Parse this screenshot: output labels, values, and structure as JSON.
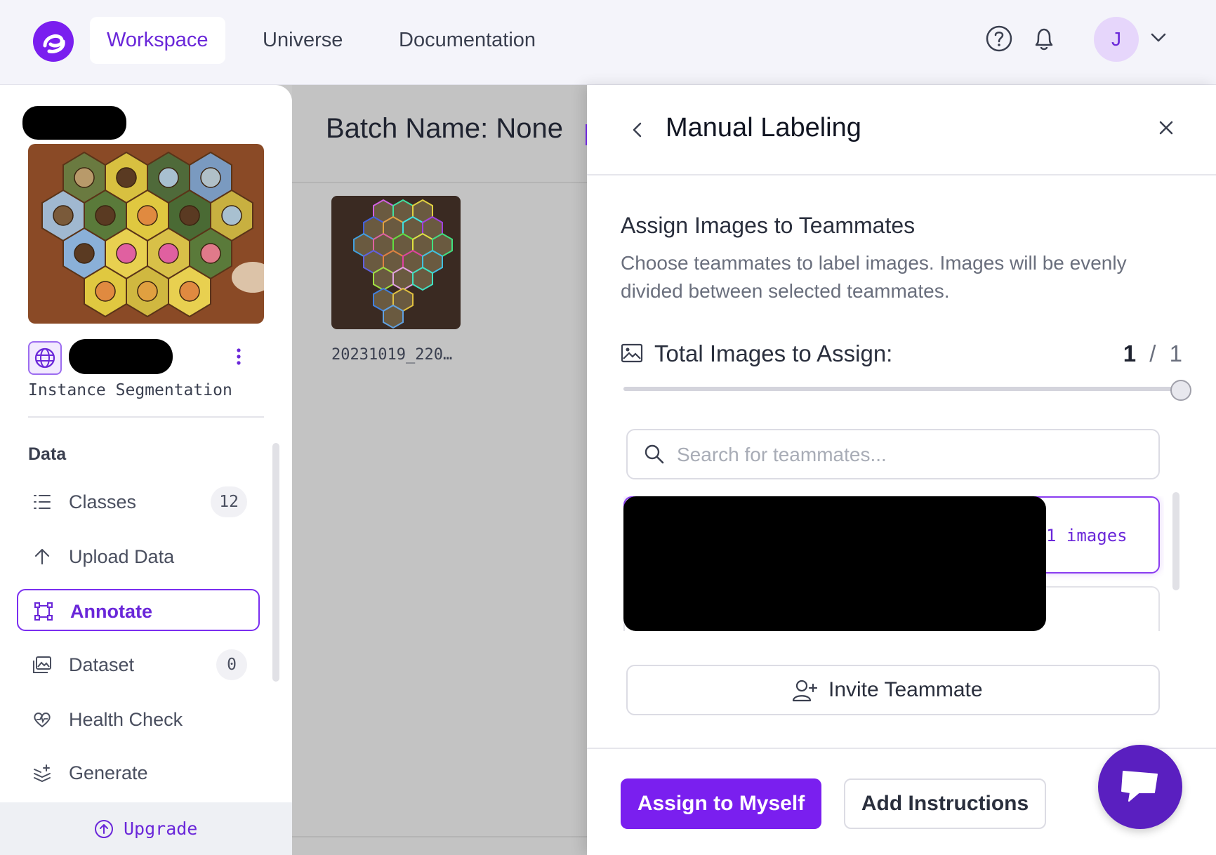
{
  "topbar": {
    "tabs": [
      {
        "label": "Workspace",
        "active": true
      },
      {
        "label": "Universe",
        "active": false
      },
      {
        "label": "Documentation",
        "active": false
      }
    ],
    "avatar_initial": "J",
    "icons": [
      "help-icon",
      "bell-icon",
      "chevron-down-icon"
    ]
  },
  "sidebar": {
    "project_type": "Instance Segmentation",
    "section_title": "Data",
    "items": [
      {
        "label": "Classes",
        "count": "12",
        "icon": "list-icon"
      },
      {
        "label": "Upload Data",
        "icon": "upload-arrow-icon"
      },
      {
        "label": "Annotate",
        "icon": "annotate-icon",
        "active": true
      },
      {
        "label": "Dataset",
        "count": "0",
        "icon": "images-icon"
      },
      {
        "label": "Health Check",
        "icon": "heart-pulse-icon"
      },
      {
        "label": "Generate",
        "icon": "generate-icon"
      }
    ],
    "upgrade_label": "Upgrade"
  },
  "main": {
    "batch_title": "Batch Name: None",
    "thumbnail_name": "20231019_220…"
  },
  "drawer": {
    "title": "Manual Labeling",
    "assign_title": "Assign Images to Teammates",
    "assign_description": "Choose teammates to label images. Images will be evenly divided between selected teammates.",
    "total_label": "Total Images to Assign:",
    "total_current": "1",
    "total_separator": "/",
    "total_max": "1",
    "slider_fraction": 1.0,
    "search_placeholder": "Search for teammates...",
    "teammate_images": "1 images",
    "invite_label": "Invite Teammate",
    "assign_myself_label": "Assign to Myself",
    "add_instructions_label": "Add Instructions"
  },
  "colors": {
    "accent": "#7a1fef",
    "accent_text": "#6a27d9",
    "chat_fab": "#5a1fc0"
  }
}
